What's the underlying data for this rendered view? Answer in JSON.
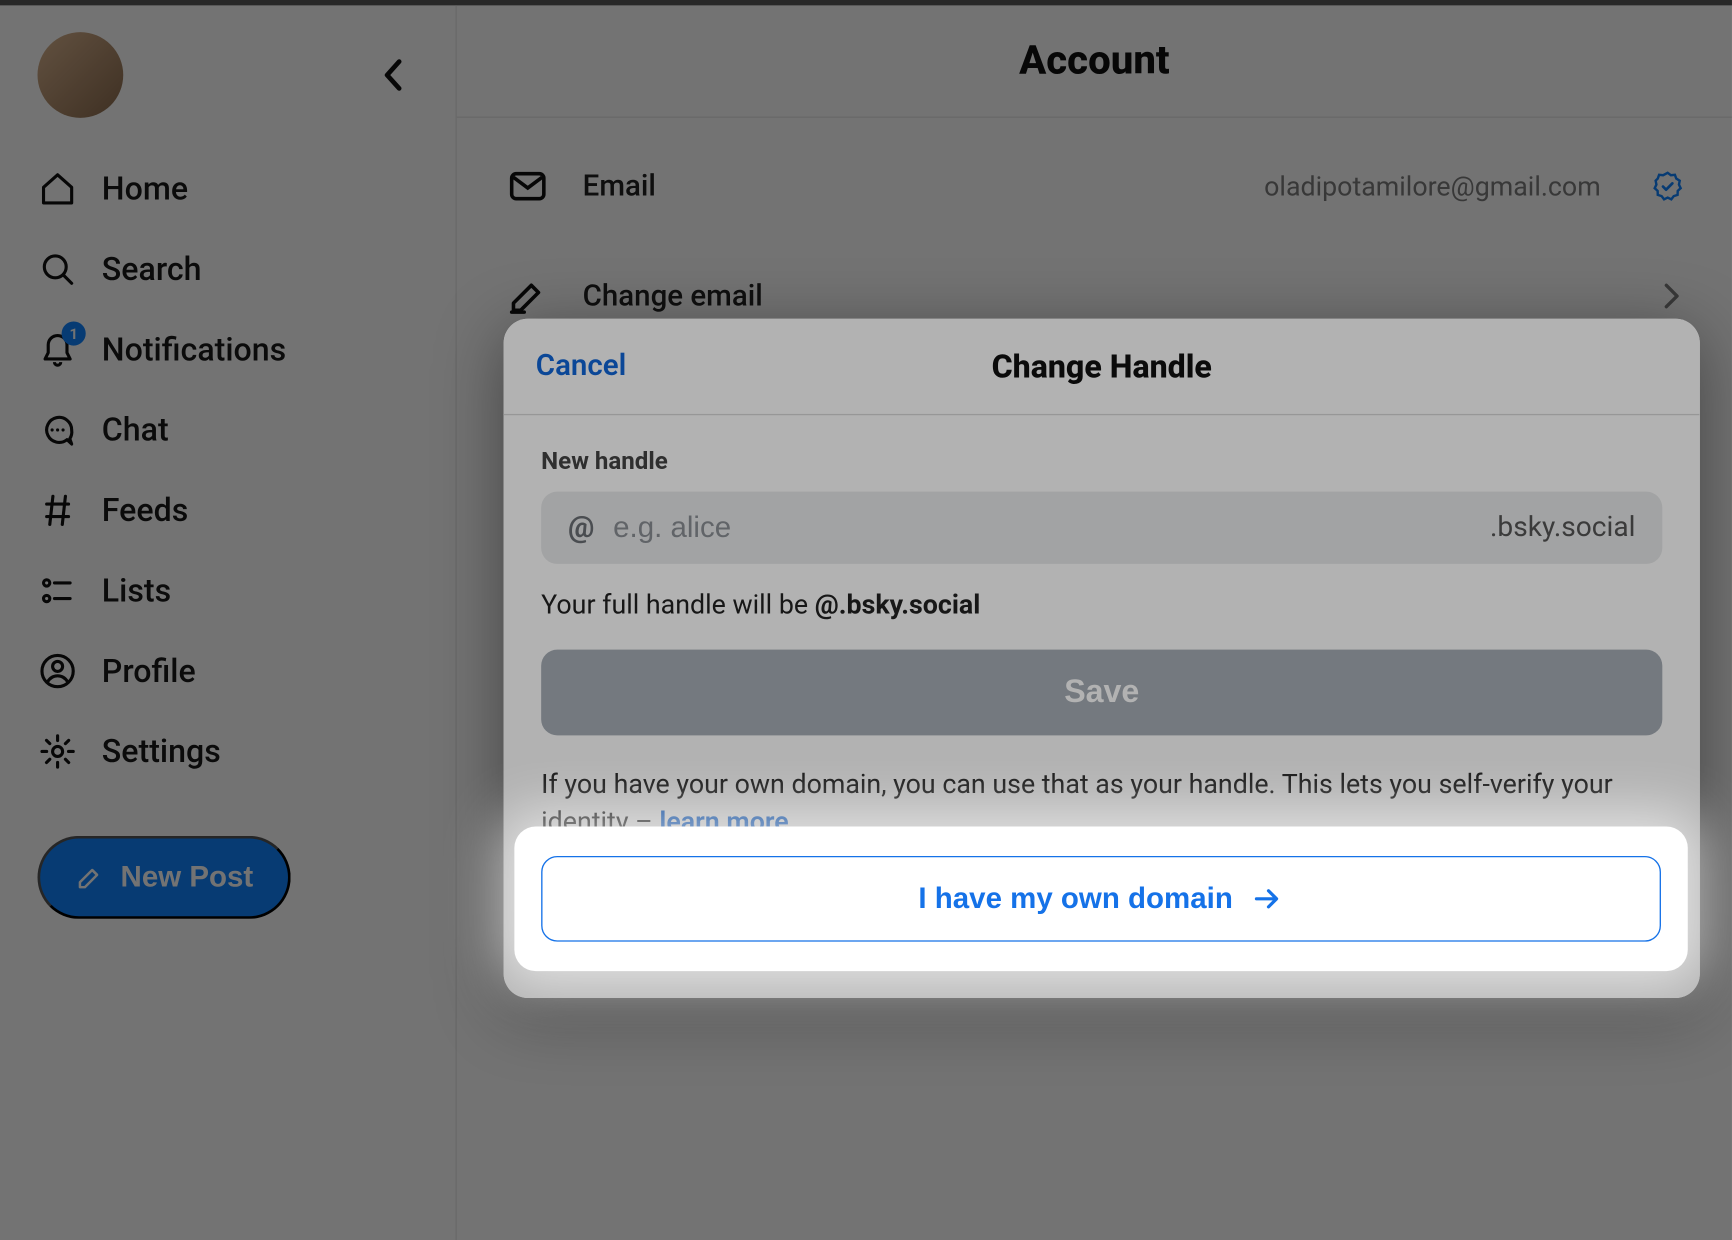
{
  "sidebar": {
    "items": [
      {
        "label": "Home"
      },
      {
        "label": "Search"
      },
      {
        "label": "Notifications",
        "badge": "1"
      },
      {
        "label": "Chat"
      },
      {
        "label": "Feeds"
      },
      {
        "label": "Lists"
      },
      {
        "label": "Profile"
      },
      {
        "label": "Settings"
      }
    ],
    "new_post_label": "New Post"
  },
  "page": {
    "title": "Account",
    "email_label": "Email",
    "email_value": "oladipotamilore@gmail.com",
    "change_email_label": "Change email"
  },
  "modal": {
    "cancel": "Cancel",
    "title": "Change Handle",
    "field_label": "New handle",
    "placeholder": "e.g. alice",
    "at": "@",
    "suffix": ".bsky.social",
    "full_prefix": "Your full handle will be ",
    "full_value": "@.bsky.social",
    "save": "Save",
    "hint_text": "If you have your own domain, you can use that as your handle. This lets you self-verify your identity – ",
    "hint_link": "learn more",
    "hint_period": ".",
    "own_domain": "I have my own domain"
  }
}
